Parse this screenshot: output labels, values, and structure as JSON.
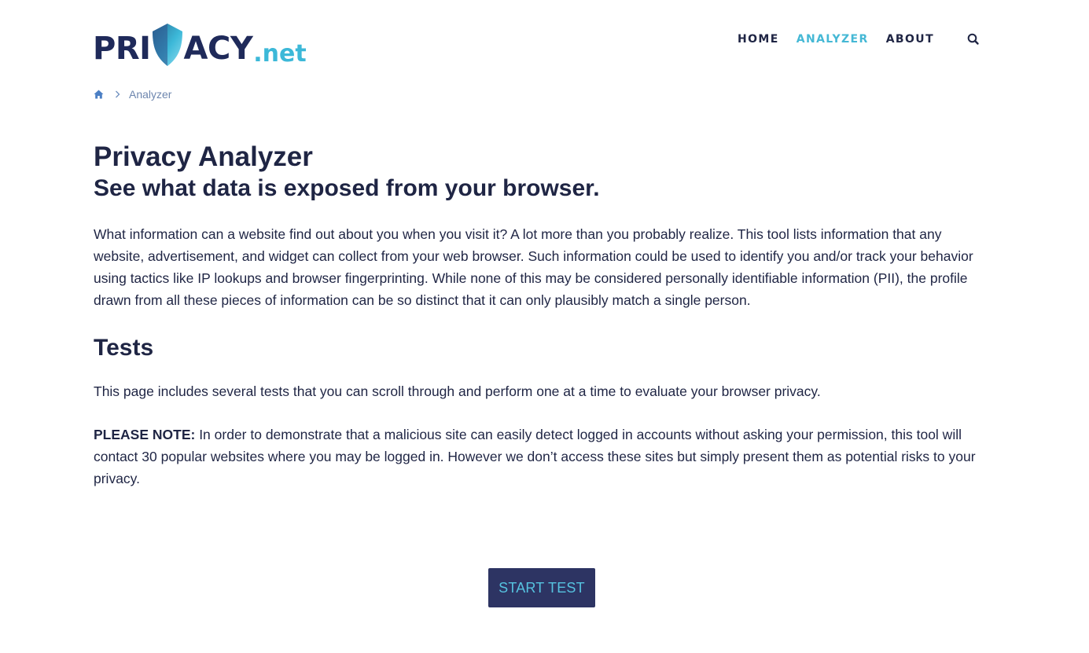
{
  "brand": {
    "logo_text_left": "PRI",
    "logo_text_right": "ACY",
    "logo_tld": ".net",
    "colors": {
      "navy": "#1f2a5a",
      "accent": "#45b8d5",
      "button_bg": "#2d3463"
    }
  },
  "nav": {
    "items": [
      {
        "label": "HOME",
        "active": false
      },
      {
        "label": "ANALYZER",
        "active": true
      },
      {
        "label": "ABOUT",
        "active": false
      }
    ],
    "search_icon": "search-icon"
  },
  "breadcrumb": {
    "home_icon": "home-icon",
    "separator_icon": "chevron-right-icon",
    "current": "Analyzer"
  },
  "main": {
    "title": "Privacy Analyzer",
    "subtitle": "See what data is exposed from your browser.",
    "intro": "What information can a website find out about you when you visit it? A lot more than you probably realize. This tool lists information that any website, advertisement, and widget can collect from your web browser. Such information could be used to identify you and/or track your behavior using tactics like IP lookups and browser fingerprinting. While none of this may be considered personally identifiable information (PII), the profile drawn from all these pieces of information can be so distinct that it can only plausibly match a single person.",
    "tests_heading": "Tests",
    "tests_text": "This page includes several tests that you can scroll through and perform one at a time to evaluate your browser privacy.",
    "note_label": "PLEASE NOTE:",
    "note_text": " In order to demonstrate that a malicious site can easily detect logged in accounts without asking your permission, this tool will contact 30 popular websites where you may be logged in. However we don’t access these sites but simply present them as potential risks to your privacy.",
    "start_button": "START TEST"
  }
}
